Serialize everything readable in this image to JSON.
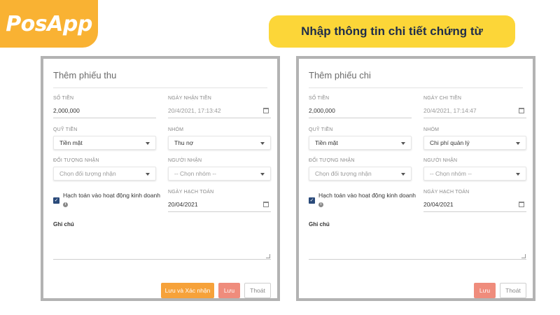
{
  "logo": {
    "text": "PosApp"
  },
  "banner": {
    "text": "Nhập thông tin chi tiết chứng từ"
  },
  "receipt": {
    "title": "Thêm phiếu thu",
    "amount_label": "SỐ TIỀN",
    "amount_value": "2,000,000",
    "date_label": "NGÀY NHẬN TIỀN",
    "date_value": "20/4/2021, 17:13:42",
    "fund_label": "QUỸ TIỀN",
    "fund_value": "Tiền mặt",
    "group_label": "NHÓM",
    "group_value": "Thu nợ",
    "target_label": "ĐỐI TƯỢNG NHẬN",
    "target_placeholder": "Chọn đối tượng nhận",
    "person_label": "NGƯỜI NHẬN",
    "person_placeholder": "-- Chọn nhóm --",
    "accounting_check_label": "Hạch toán vào hoạt động kinh doanh",
    "accounting_date_label": "NGÀY HẠCH TOÁN",
    "accounting_date_value": "20/04/2021",
    "note_label": "Ghi chú",
    "btn_save_confirm": "Lưu và Xác nhận",
    "btn_save": "Lưu",
    "btn_exit": "Thoát"
  },
  "payment": {
    "title": "Thêm phiếu chi",
    "amount_label": "SỐ TIỀN",
    "amount_value": "2,000,000",
    "date_label": "NGÀY CHI TIỀN",
    "date_value": "20/4/2021, 17:14:47",
    "fund_label": "QUỸ TIỀN",
    "fund_value": "Tiền mặt",
    "group_label": "NHÓM",
    "group_value": "Chi phí quản lý",
    "target_label": "ĐỐI TƯỢNG NHẬN",
    "target_placeholder": "Chọn đối tượng nhận",
    "person_label": "NGƯỜI NHẬN",
    "person_placeholder": "-- Chọn nhóm --",
    "accounting_check_label": "Hạch toán vào hoạt động kinh doanh",
    "accounting_date_label": "NGÀY HẠCH TOÁN",
    "accounting_date_value": "20/04/2021",
    "note_label": "Ghi chú",
    "btn_save": "Lưu",
    "btn_exit": "Thoát"
  },
  "colors": {
    "logo_bg": "#f9b233",
    "banner_bg": "#fcd638",
    "checkbox": "#2a4a7a",
    "btn_orange": "#f6a23a",
    "btn_salmon": "#ef8c7c"
  }
}
